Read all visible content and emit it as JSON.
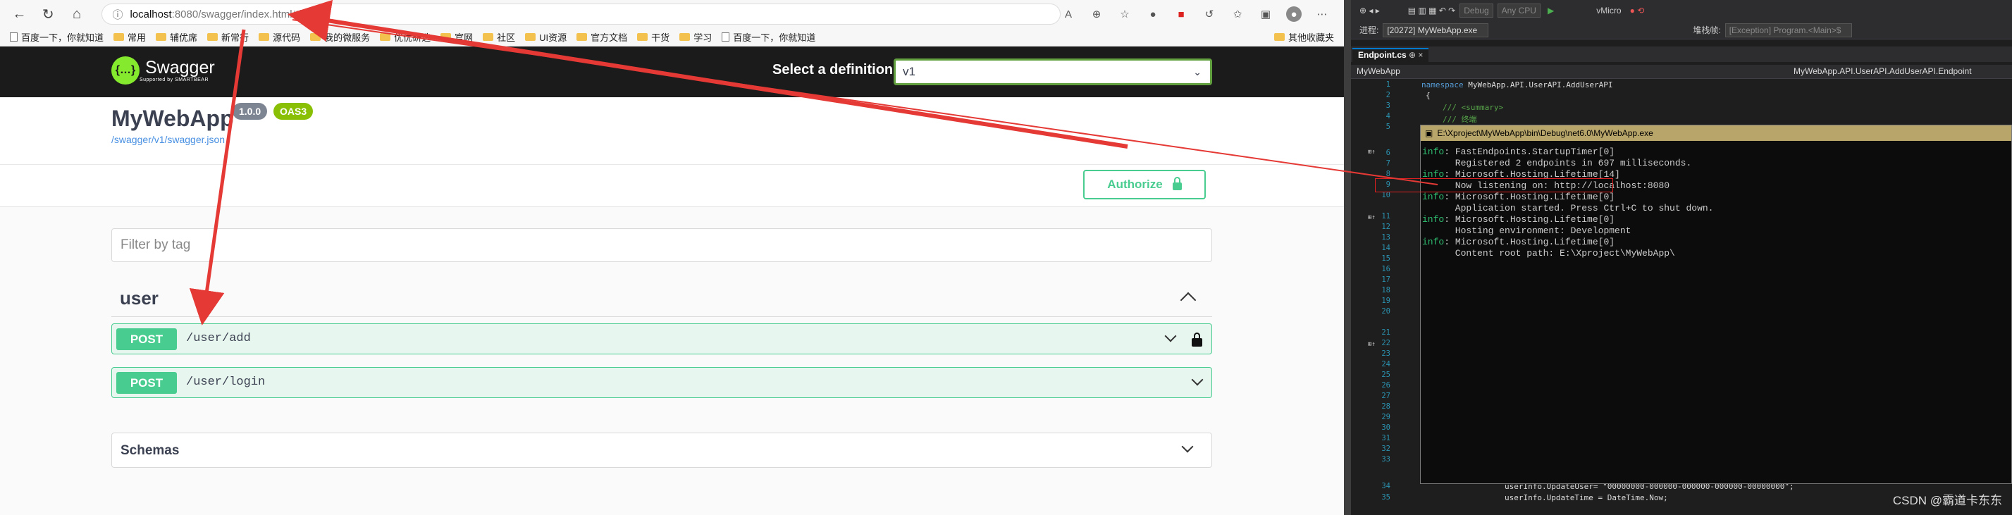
{
  "browser": {
    "url_host": "localhost",
    "url_path": ":8080/swagger/index.html#/",
    "bookmarks": [
      "百度一下，你就知道",
      "常用",
      "辅优席",
      "新常行",
      "源代码",
      "我的微服务",
      "优优研选",
      "官网",
      "社区",
      "UI资源",
      "官方文档",
      "干货",
      "学习",
      "百度一下，你就知道"
    ],
    "bookmarks_last": "其他收藏夹"
  },
  "swagger": {
    "logo_text": "Swagger",
    "logo_sub": "Supported by SMARTBEAR",
    "select_label": "Select a definition",
    "select_value": "v1",
    "title": "MyWebApp",
    "version": "1.0.0",
    "oas": "OAS3",
    "spec_link": "/swagger/v1/swagger.json",
    "authorize": "Authorize",
    "filter_placeholder": "Filter by tag",
    "tag": "user",
    "ops": [
      {
        "method": "POST",
        "path": "/user/add",
        "locked": true
      },
      {
        "method": "POST",
        "path": "/user/login",
        "locked": false
      }
    ],
    "schemas": "Schemas"
  },
  "ide": {
    "debug": "Debug",
    "cpu": "Any CPU",
    "micro": "vMicro",
    "process_label": "进程:",
    "process": "[20272] MyWebApp.exe",
    "thread_label": "堆栈帧:",
    "exception": "[Exception] Program.<Main>$",
    "tab": "Endpoint.cs",
    "nav_left": "MyWebApp",
    "nav_right": "MyWebApp.API.UserAPI.AddUserAPI.Endpoint",
    "code_ns": "namespace",
    "code_ns_name": " MyWebApp.API.UserAPI.AddUserAPI",
    "code_brace": "{",
    "code_summary": "/// <summary>",
    "code_comment": "/// 终端",
    "code_line34": "userInfo.UpdateUser= \"00000000-000000-000000-000000-00000000\";",
    "code_line35": "userInfo.UpdateTime = DateTime.Now;",
    "console_title": "E:\\Xproject\\MyWebApp\\bin\\Debug\\net6.0\\MyWebApp.exe",
    "console_lines": [
      {
        "tag": "info",
        "text": ": FastEndpoints.StartupTimer[0]"
      },
      {
        "tag": "",
        "text": "      Registered 2 endpoints in 697 milliseconds."
      },
      {
        "tag": "info",
        "text": ": Microsoft.Hosting.Lifetime[14]"
      },
      {
        "tag": "",
        "text": "      Now listening on: http://localhost:8080"
      },
      {
        "tag": "info",
        "text": ": Microsoft.Hosting.Lifetime[0]"
      },
      {
        "tag": "",
        "text": "      Application started. Press Ctrl+C to shut down."
      },
      {
        "tag": "info",
        "text": ": Microsoft.Hosting.Lifetime[0]"
      },
      {
        "tag": "",
        "text": "      Hosting environment: Development"
      },
      {
        "tag": "info",
        "text": ": Microsoft.Hosting.Lifetime[0]"
      },
      {
        "tag": "",
        "text": "      Content root path: E:\\Xproject\\MyWebApp\\"
      }
    ],
    "watermark": "CSDN @霸道卡东东"
  }
}
